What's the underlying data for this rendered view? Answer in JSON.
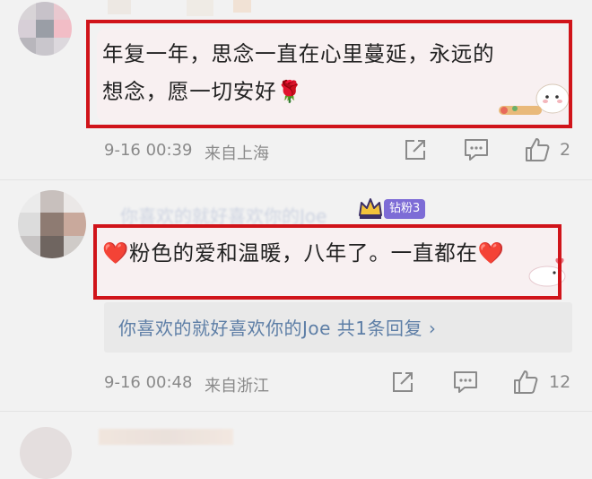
{
  "comments": [
    {
      "text_line1": "年复一年，思念一直在心里蔓延，永远的",
      "text_line2": "想念，愿一切安好🌹",
      "time": "9-16 00:39",
      "location": "来自上海",
      "like_count": "2"
    },
    {
      "username": "你喜欢的就好喜欢你的Joe",
      "badge": "钻粉3",
      "text": "❤️粉色的爱和温暖，八年了。一直都在❤️",
      "reply_summary": "你喜欢的就好喜欢你的Joe 共1条回复 ›",
      "time": "9-16 00:48",
      "location": "来自浙江",
      "like_count": "12"
    }
  ],
  "icons": {
    "share": "share-icon",
    "comment": "comment-icon",
    "like": "thumbs-up-icon",
    "crown": "crown-icon"
  },
  "colors": {
    "highlight_border": "#d0141a",
    "link_blue": "#5d7ea6",
    "meta_gray": "#8a8a8a",
    "badge_purple": "#7d6cd6"
  }
}
